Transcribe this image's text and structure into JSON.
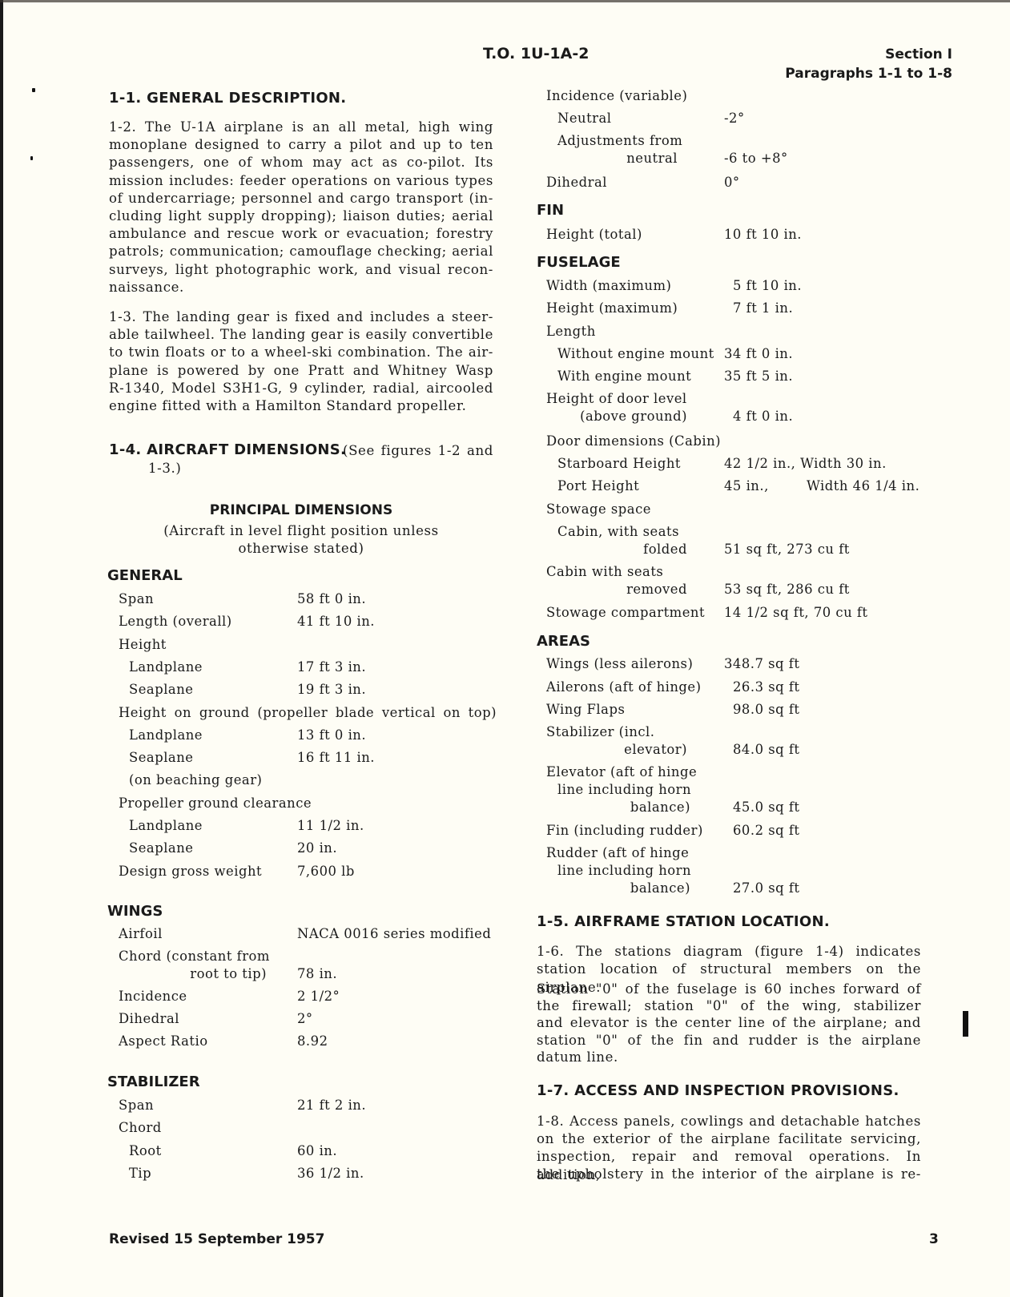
{
  "header": {
    "doc_number": "T.O. 1U-1A-2",
    "section": "Section I",
    "paragraphs": "Paragraphs 1-1 to 1-8"
  },
  "left": {
    "p1_1_heading": "1-1.  GENERAL DESCRIPTION.",
    "p1_2_lines": [
      "1-2. The U-1A airplane is an all metal, high wing",
      "monoplane designed to carry a pilot and up to ten",
      "passengers, one of whom may act as co-pilot. Its",
      "mission includes: feeder operations on various types",
      "of undercarriage; personnel and cargo transport (in-",
      "cluding light supply dropping); liaison duties; aerial",
      "ambulance and rescue work or evacuation; forestry",
      "patrols; communication; camouflage checking; aerial",
      "surveys, light photographic work, and visual recon-",
      "naissance."
    ],
    "p1_3_lines": [
      "1-3. The landing gear is fixed and includes a steer-",
      "able tailwheel. The landing gear is easily convertible",
      "to twin floats or to a wheel-ski combination. The air-",
      "plane is powered by one Pratt and Whitney Wasp",
      "R-1340, Model S3H1-G, 9 cylinder, radial, aircooled",
      "engine fitted with a Hamilton Standard propeller."
    ],
    "p1_4_heading_bold": "1-4.  AIRCRAFT DIMENSIONS.",
    "p1_4_heading_rest": "(See figures 1-2 and",
    "p1_4_heading_cont": "1-3.)",
    "principal_title": "PRINCIPAL DIMENSIONS",
    "principal_sub1": "(Aircraft in level flight position unless",
    "principal_sub2": "otherwise stated)",
    "general_title": "GENERAL",
    "general_rows": [
      {
        "label": "Span",
        "value": "58 ft 0 in.",
        "indent": 1
      },
      {
        "label": "Length (overall)",
        "value": "41 ft 10 in.",
        "indent": 1
      },
      {
        "label": "Height",
        "value": "",
        "indent": 1
      },
      {
        "label": "Landplane",
        "value": "17 ft 3 in.",
        "indent": 2
      },
      {
        "label": "Seaplane",
        "value": "19 ft 3 in.",
        "indent": 2
      },
      {
        "label": "Height on ground (propeller blade vertical on top)",
        "value": "",
        "indent": 1
      },
      {
        "label": "Landplane",
        "value": "13 ft 0 in.",
        "indent": 2
      },
      {
        "label": "Seaplane",
        "value": "16 ft 11 in.",
        "indent": 2
      },
      {
        "label": "(on beaching gear)",
        "value": "",
        "indent": 2
      },
      {
        "label": "Propeller ground clearance",
        "value": "",
        "indent": 1
      },
      {
        "label": "Landplane",
        "value": "11 1/2 in.",
        "indent": 2
      },
      {
        "label": "Seaplane",
        "value": "20 in.",
        "indent": 2
      },
      {
        "label": "Design gross weight",
        "value": "7,600 lb",
        "indent": 1
      }
    ],
    "wings_title": "WINGS",
    "wings_rows": [
      {
        "label": "Airfoil",
        "value": "NACA 0016 series modified"
      },
      {
        "label": "Chord (constant from",
        "label2": "root to tip)",
        "value": "78 in."
      },
      {
        "label": "Incidence",
        "value": "2 1/2°"
      },
      {
        "label": "Dihedral",
        "value": "2°"
      },
      {
        "label": "Aspect Ratio",
        "value": "8.92"
      }
    ],
    "stab_title": "STABILIZER",
    "stab_rows": [
      {
        "label": "Span",
        "value": "21 ft 2 in.",
        "indent": 1
      },
      {
        "label": "Chord",
        "value": "",
        "indent": 1
      },
      {
        "label": "Root",
        "value": "60 in.",
        "indent": 2
      },
      {
        "label": "Tip",
        "value": "36 1/2 in.",
        "indent": 2
      }
    ]
  },
  "right": {
    "stab_cont_rows": [
      {
        "label": "Incidence (variable)",
        "value": "",
        "indent": 1
      },
      {
        "label": "Neutral",
        "value": "-2°",
        "indent": 2
      },
      {
        "label": "Adjustments from",
        "label2": "neutral",
        "value": "-6 to +8°",
        "indent": 2
      },
      {
        "label": "Dihedral",
        "value": "0°",
        "indent": 1
      }
    ],
    "fin_title": "FIN",
    "fin_rows": [
      {
        "label": "Height (total)",
        "value": "10 ft 10 in."
      }
    ],
    "fuselage_title": "FUSELAGE",
    "fuselage_rows": [
      {
        "label": "Width (maximum)",
        "value": "5 ft 10 in."
      },
      {
        "label": "Height (maximum)",
        "value": "7 ft 1 in."
      },
      {
        "label": "Length",
        "value": ""
      },
      {
        "label": "Without engine mount",
        "value": "34 ft 0 in."
      },
      {
        "label": "With engine mount",
        "value": "35 ft 5 in."
      },
      {
        "label": "Height of door level",
        "label2": "(above ground)",
        "value": "4 ft 0 in."
      },
      {
        "label": "Door dimensions (Cabin)",
        "value": ""
      },
      {
        "label": "Starboard Height",
        "value": "42 1/2 in., Width 30 in."
      },
      {
        "label": "Port Height",
        "value": "45 in.,",
        "value2": "Width 46 1/4 in."
      },
      {
        "label": "Stowage space",
        "value": ""
      },
      {
        "label": "Cabin, with seats",
        "label2": "folded",
        "value": "51 sq ft, 273 cu ft"
      },
      {
        "label": "Cabin with seats",
        "label2": "removed",
        "value": "53 sq ft, 286 cu ft"
      },
      {
        "label": "Stowage compartment",
        "value": "14 1/2 sq ft, 70 cu ft"
      }
    ],
    "areas_title": "AREAS",
    "areas_rows": [
      {
        "label": "Wings (less ailerons)",
        "value": "348.7 sq ft"
      },
      {
        "label": "Ailerons (aft of hinge)",
        "value": "26.3 sq ft"
      },
      {
        "label": "Wing Flaps",
        "value": "98.0 sq ft"
      },
      {
        "label": "Stabilizer (incl.",
        "label2": "elevator)",
        "value": "84.0 sq ft"
      },
      {
        "label": "Elevator (aft of hinge",
        "label2": "line including horn",
        "label3": "balance)",
        "value": "45.0 sq ft"
      },
      {
        "label": "Fin (including rudder)",
        "value": "60.2 sq ft"
      },
      {
        "label": "Rudder (aft of hinge",
        "label2": "line including horn",
        "label3": "balance)",
        "value": "27.0 sq ft"
      }
    ],
    "p1_5_heading": "1-5.  AIRFRAME STATION LOCATION.",
    "p1_6_lines": [
      "1-6. The stations diagram (figure 1-4) indicates",
      "station location of structural members on the airplane.",
      "Station \"0\" of the fuselage is 60 inches forward of",
      "the firewall; station \"0\" of the wing, stabilizer",
      "and elevator is the center line of the airplane; and",
      "station \"0\" of the fin and rudder is the airplane",
      "datum line."
    ],
    "p1_7_heading": "1-7.  ACCESS AND INSPECTION PROVISIONS.",
    "p1_8_lines": [
      "1-8. Access panels, cowlings and detachable hatches",
      "on the exterior of the airplane facilitate servicing,",
      "inspection, repair and removal operations. In addition,",
      "the upholstery in the interior of the airplane is re-"
    ]
  },
  "footer": {
    "revised": "Revised 15 September 1957",
    "page_number": "3"
  }
}
